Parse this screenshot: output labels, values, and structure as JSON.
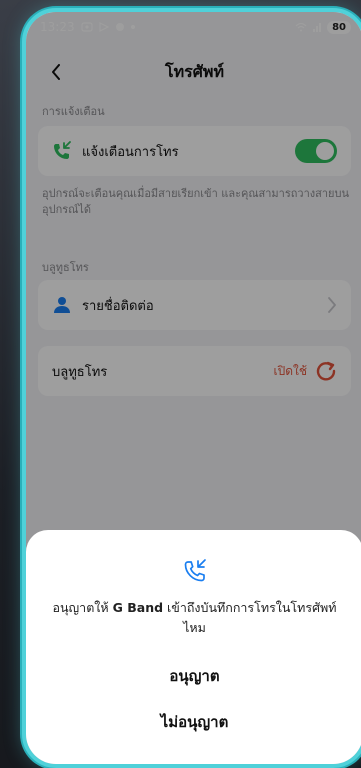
{
  "status_bar": {
    "time": "13:23",
    "battery": "80"
  },
  "header": {
    "title": "โทรศัพท์"
  },
  "notifications": {
    "section_label": "การแจ้งเตือน",
    "call_alert_label": "แจ้งเตือนการโทร",
    "toggle_on": true,
    "description": "อุปกรณ์จะเตือนคุณเมื่อมีสายเรียกเข้า และคุณสามารถวางสายบนอุปกรณ์ได้"
  },
  "bluetooth_call": {
    "section_label": "บลูทูธโทร",
    "contacts_label": "รายชื่อติดต่อ",
    "row_label": "บลูทูธโทร",
    "row_status": "เปิดใช้"
  },
  "dialog": {
    "message_prefix": "อนุญาตให้ ",
    "app_name": "G Band",
    "message_suffix": " เข้าถึงบันทึกการโทรในโทรศัพท์ไหม",
    "allow_label": "อนุญาต",
    "deny_label": "ไม่อนุญาต"
  },
  "colors": {
    "accent_green": "#2fbf5f",
    "accent_blue": "#1a7ef0",
    "status_red": "#e2533a",
    "frame_cyan": "#4fd1d9"
  }
}
